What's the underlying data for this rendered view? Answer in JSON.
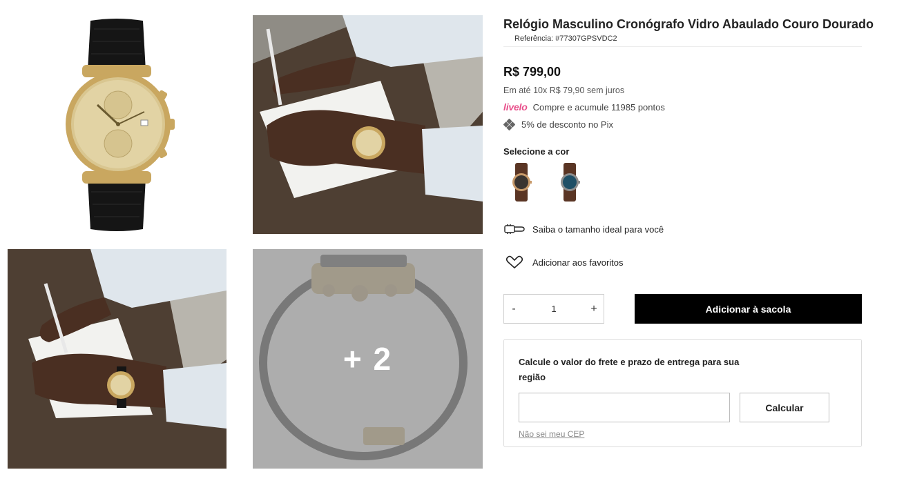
{
  "gallery": {
    "more_count": "+ 2"
  },
  "product": {
    "title": "Relógio Masculino Cronógrafo Vidro Abaulado Couro Dourado",
    "reference": "Referência: #77307GPSVDC2",
    "price": "R$ 799,00",
    "installments": "Em até 10x R$ 79,90 sem juros",
    "livelo_logo": "livelo",
    "livelo_text": "Compre e acumule 11985 pontos",
    "pix_text": "5% de desconto no Pix",
    "color_label": "Selecione a cor",
    "colors": [
      {
        "dial": "#3a3430",
        "case": "#c89a6a",
        "strap": "#5a3524"
      },
      {
        "dial": "#1f4f66",
        "case": "#8d8d8d",
        "strap": "#5a3524"
      }
    ],
    "size_link": "Saiba o tamanho ideal para você",
    "favorite_link": "Adicionar aos favoritos"
  },
  "cart": {
    "minus": "-",
    "quantity": "1",
    "plus": "+",
    "add_button": "Adicionar à sacola"
  },
  "shipping": {
    "title": "Calcule o valor do frete e prazo de entrega para sua região",
    "cep_value": "",
    "calc_button": "Calcular",
    "no_cep_link": "Não sei meu CEP"
  },
  "colors": {
    "accent": "#000000",
    "livelo": "#e84e8a",
    "gold": "#c9a760"
  }
}
